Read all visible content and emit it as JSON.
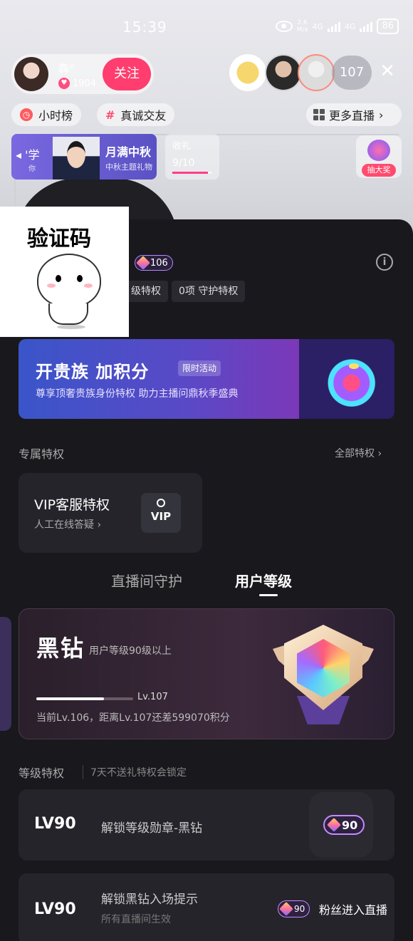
{
  "status_bar": {
    "time": "15:39",
    "net_speed": "2.6",
    "net_unit": "M/s",
    "signal_1": "4G",
    "signal_2": "4G",
    "battery": "86"
  },
  "host": {
    "name": "犇⁰",
    "likes": "1904",
    "follow_label": "关注"
  },
  "viewers": {
    "count": "107"
  },
  "chips": {
    "rank": "小时榜",
    "topic": "真诚交友",
    "more_live": "更多直播"
  },
  "banner": {
    "left_text": "'学",
    "left_sub": "你",
    "title": "月满中秋",
    "subtitle": "中秋主题礼物"
  },
  "gift_goal": {
    "label": "收礼",
    "count": "9/10",
    "progress": 0.9
  },
  "lottery": {
    "label": "抽大奖"
  },
  "captcha": {
    "title": "验证码"
  },
  "panel": {
    "fan_level": "106",
    "tags": [
      "级特权",
      "0项 守护特权"
    ],
    "promo": {
      "title": "开贵族 加积分",
      "tag": "限时活动",
      "subtitle": "尊享顶奢贵族身份特权 助力主播问鼎秋季盛典"
    },
    "exclusive": {
      "title": "专属特权",
      "all_link": "全部特权 ›",
      "vip_title": "VIP客服特权",
      "vip_sub": "人工在线答疑 ›",
      "vip_icon": "VIP"
    },
    "tabs": [
      "直播间守护",
      "用户等级"
    ],
    "active_tab": "用户等级",
    "level": {
      "name": "黑钻",
      "desc": "用户等级90级以上",
      "next_label": "Lv.107",
      "progress": 0.7,
      "current_info": "当前Lv.106，距离Lv.107还差599070积分"
    },
    "privileges": {
      "title": "等级特权",
      "note": "7天不送礼特权会锁定",
      "items": [
        {
          "level": "LV90",
          "title": "解锁等级勋章-黑钻",
          "badge": "90"
        },
        {
          "level": "LV90",
          "title": "解锁黑钻入场提示",
          "sub": "所有直播间生效",
          "badge": "90",
          "entry_text": "粉丝进入直播"
        }
      ]
    }
  },
  "colors": {
    "accent_pink": "#ff3d6e",
    "panel_bg": "#19181d",
    "card_bg": "#25242b",
    "badge_purple": "#c38bff"
  }
}
